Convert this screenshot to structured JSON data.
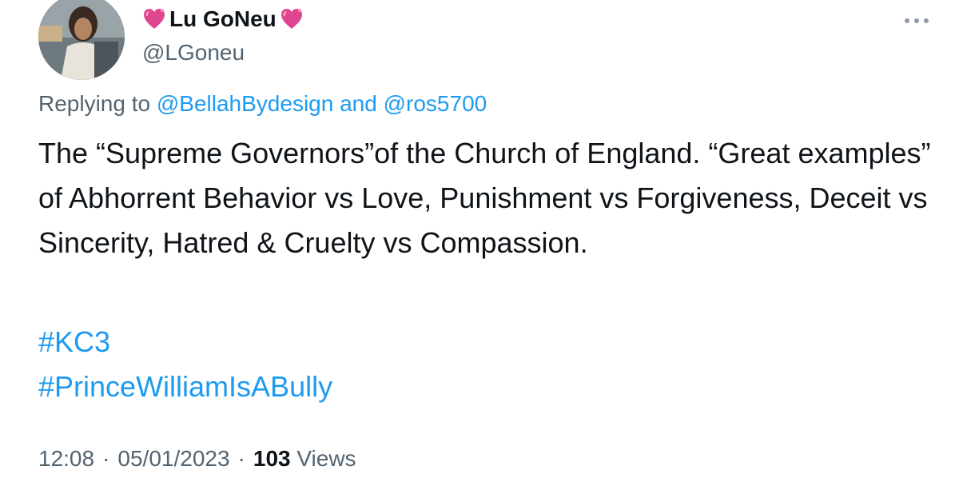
{
  "tweet": {
    "display_name": "Lu GoNeu",
    "handle": "@LGoneu",
    "prefix_emoji": "sparkling-heart",
    "suffix_emoji": "sparkling-heart",
    "replying_prefix": "Replying to",
    "reply_mention_1": "@BellahBydesign",
    "reply_and": "and",
    "reply_mention_2": "@ros5700",
    "body": "The “Supreme Governors”of the Church of England. “Great examples” of Abhorrent Behavior vs Love, Punishment vs Forgiveness, Deceit vs Sincerity, Hatred & Cruelty vs Compassion.",
    "hashtags": [
      "#KC3",
      "#PrinceWilliamIsABully"
    ],
    "time": "12:08",
    "separator": "·",
    "date": "05/01/2023",
    "view_count": "103",
    "views_label": "Views"
  },
  "colors": {
    "text": "#0f1419",
    "secondary": "#536471",
    "link": "#1d9bf0",
    "heart": "#e0468f"
  },
  "icons": {
    "more": "more-options-icon"
  }
}
